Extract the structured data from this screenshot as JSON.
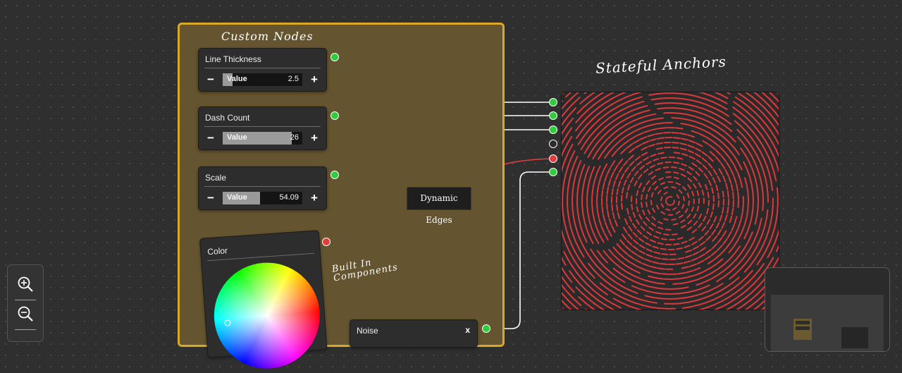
{
  "annotations": {
    "custom_nodes": "Custom Nodes",
    "stateful_anchors": "Stateful Anchors",
    "built_in_line1": "Built In",
    "built_in_line2": "Components",
    "dynamic_edges": "Dynamic Edges"
  },
  "nodes": {
    "line_thickness": {
      "title": "Line Thickness",
      "label": "Value",
      "value": "2.5",
      "fill": 0.12
    },
    "dash_count": {
      "title": "Dash Count",
      "label": "Value",
      "value": "26",
      "fill": 0.87
    },
    "scale": {
      "title": "Scale",
      "label": "Value",
      "value": "54.09",
      "fill": 0.47
    },
    "color": {
      "title": "Color"
    },
    "noise": {
      "title": "Noise",
      "close": "x"
    }
  },
  "stepper": {
    "minus": "−",
    "plus": "+"
  },
  "colors": {
    "group_bg": "#64542f",
    "group_border": "#d9a826",
    "port_green": "#2fcd3d",
    "port_red": "#e03e3e",
    "edge_white": "#ffffff",
    "edge_red": "#e03e3e",
    "dash_red": "#d9393c"
  },
  "icons": {
    "zoom_in": "zoom-in-icon",
    "zoom_out": "zoom-out-icon"
  }
}
